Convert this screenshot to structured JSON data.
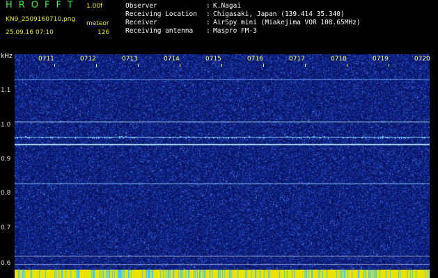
{
  "header": {
    "app_title": "HROFFT",
    "version": "1.00f",
    "filename": "KN9_2509160710.png",
    "mode": "meteor",
    "datetime": "25.09.16 07:10",
    "count": "126",
    "info": [
      {
        "label": "Observer",
        "value": "K.Nagai"
      },
      {
        "label": "Receiving Location",
        "value": "Chigasaki, Japan (139.414 35.340)"
      },
      {
        "label": "Receiver",
        "value": "AirSpy mini (Miakejima VOR 108.65MHz)"
      },
      {
        "label": "Receiving antenna",
        "value": "Maspro FM-3"
      }
    ]
  },
  "axis": {
    "y_unit": "kHz",
    "y_ticks": [
      "1.1",
      "1.0",
      "0.9",
      "0.8",
      "0.7",
      "0.6"
    ],
    "x_ticks": [
      "0711",
      "0712",
      "0713",
      "0714",
      "0715",
      "0716",
      "0717",
      "0718",
      "0719",
      "0720"
    ]
  },
  "colors": {
    "background": "#000000",
    "title_green": "#3cf03c",
    "header_yellow": "#e9e900",
    "spectrogram_base": "#0c1a7a",
    "signal_line": "#9fe8ff"
  }
}
